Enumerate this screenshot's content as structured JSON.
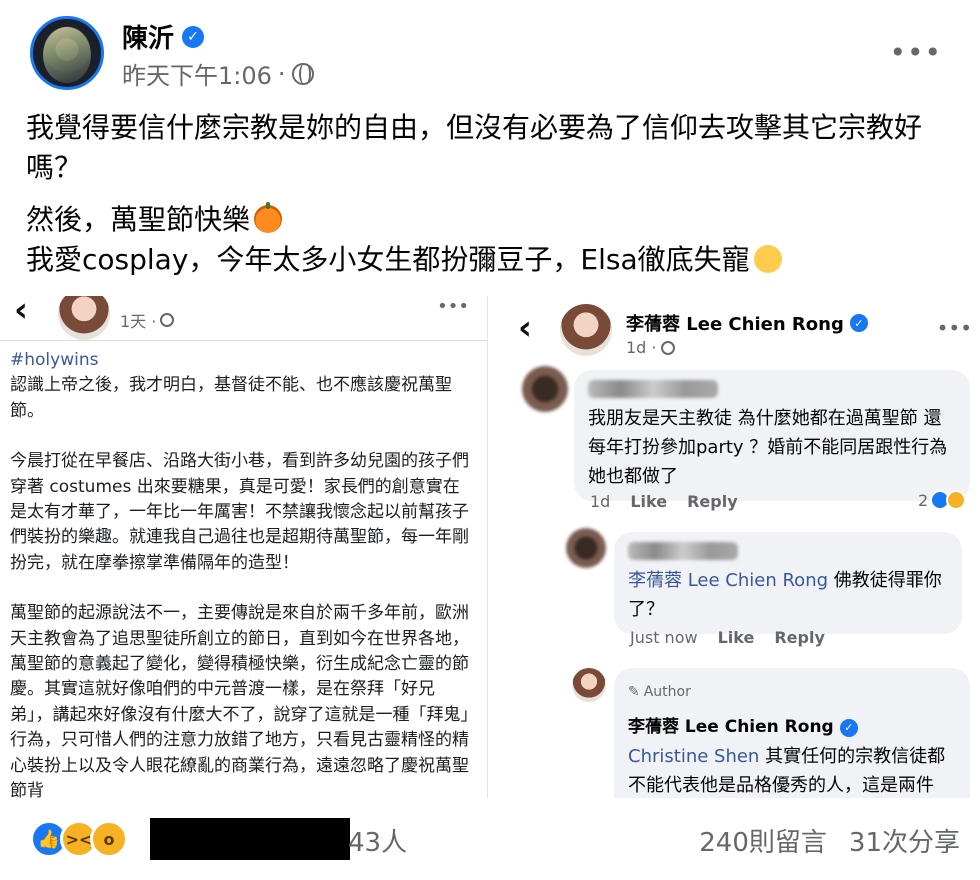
{
  "post": {
    "author_name": "陳沂",
    "timestamp": "昨天下午1:06",
    "separator": "·",
    "paragraph1": "我覺得要信什麼宗教是妳的自由，但沒有必要為了信仰去攻擊其它宗教好嗎？",
    "line2": "然後，萬聖節快樂",
    "line3": "我愛cosplay，今年太多小女生都扮彌豆子，Elsa徹底失寵"
  },
  "left_screenshot": {
    "meta_time": "1天 ·",
    "hashtag": "#holywins",
    "para1": "認識上帝之後，我才明白，基督徒不能、也不應該慶祝萬聖節。",
    "para2": "今晨打從在早餐店、沿路大街小巷，看到許多幼兒園的孩子們穿著 costumes 出來要糖果，真是可愛！家長們的創意實在是太有才華了，一年比一年厲害！不禁讓我懷念起以前幫孩子們裝扮的樂趣。就連我自己過往也是超期待萬聖節，每一年剛扮完，就在摩拳擦掌準備隔年的造型！",
    "para3": "萬聖節的起源說法不一，主要傳說是來自於兩千多年前，歐洲天主教會為了追思聖徒所創立的節日，直到如今在世界各地，萬聖節的意義起了變化，變得積極快樂，衍生成紀念亡靈的節慶。其實這就好像咱們的中元普渡一樣，是在祭拜「好兄弟」，講起來好像沒有什麼大不了，說穿了這就是一種「拜鬼」行為，只可惜人們的注意力放錯了地方，只看見古靈精怪的精心裝扮上以及令人眼花繚亂的商業行為，遠遠忽略了慶祝萬聖節背"
  },
  "right_screenshot": {
    "author_name": "李蒨蓉 Lee Chien Rong",
    "meta_time": "1d ·",
    "comment1": {
      "text": "我朋友是天主教徒 為什麼她都在過萬聖節 還每年打扮參加party ？婚前不能同居跟性行為 她也都做了",
      "time": "1d",
      "like": "Like",
      "reply": "Reply",
      "reaction_count": "2"
    },
    "comment2": {
      "mention": "李蒨蓉 Lee Chien Rong",
      "text": " 佛教徒得罪你了？",
      "time": "Just now",
      "like": "Like",
      "reply": "Reply"
    },
    "comment3": {
      "author_tag": "Author",
      "author_name": "李蒨蓉 Lee Chien Rong",
      "mention": "Christine Shen",
      "text": " 其實任何的宗教信徒都不能代表他是品格優秀的人，這是兩件事。許多流氓無賴都是佛"
    }
  },
  "footer": {
    "reaction_count_suffix": "43人",
    "comments": "240則留言",
    "shares": "31次分享"
  },
  "colors": {
    "accent": "#1877f2",
    "secondary_text": "#65676b",
    "mention": "#385898",
    "bubble_bg": "#f0f2f5"
  }
}
